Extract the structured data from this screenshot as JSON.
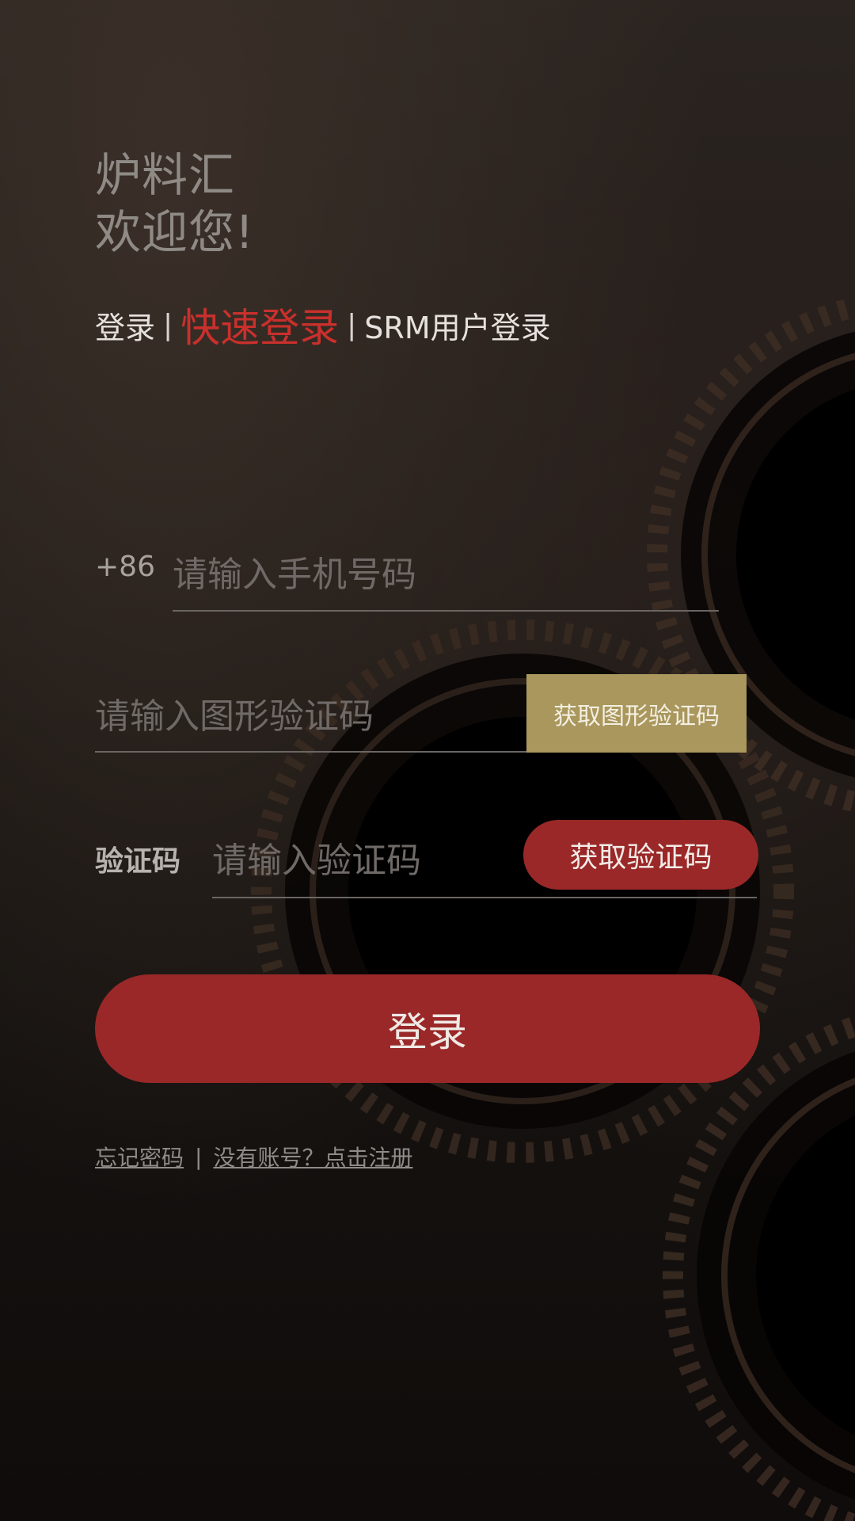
{
  "app": {
    "name": "炉料汇",
    "welcome_line2": "欢迎您!"
  },
  "tabs": {
    "login": "登录",
    "separator": "|",
    "quick_login": "快速登录",
    "srm_login": "SRM用户登录",
    "active": "quick_login"
  },
  "phone": {
    "prefix": "+86",
    "placeholder": "请输入手机号码"
  },
  "captcha": {
    "placeholder": "请输入图形验证码",
    "button_label": "获取图形验证码"
  },
  "sms_code": {
    "label": "验证码",
    "placeholder": "请输入验证码",
    "button_label": "获取验证码"
  },
  "login_button": {
    "label": "登录"
  },
  "footer_links": {
    "forgot_password": "忘记密码",
    "separator": "|",
    "register": "没有账号？点击注册"
  },
  "colors": {
    "accent_red": "#9a2828",
    "active_tab_red": "#c9302c",
    "captcha_gold": "#a9975d",
    "background_dark": "#1a1613"
  }
}
